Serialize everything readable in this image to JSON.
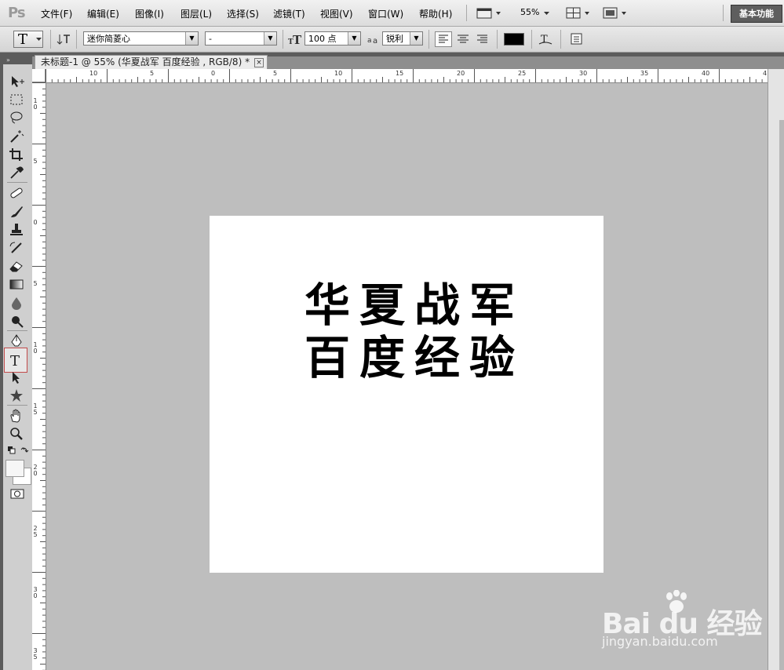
{
  "menubar": {
    "logo": "Ps",
    "items": [
      "文件(F)",
      "编辑(E)",
      "图像(I)",
      "图层(L)",
      "选择(S)",
      "滤镜(T)",
      "视图(V)",
      "窗口(W)",
      "帮助(H)"
    ],
    "zoom": "55%",
    "workspace_label": "基本功能"
  },
  "options": {
    "tool_glyph": "T",
    "font_family": "迷你简菱心",
    "font_style": "-",
    "font_size": "100 点",
    "antialias": "锐利",
    "text_color": "#000000"
  },
  "document": {
    "tab_title": "未标题-1 @ 55% (华夏战军 百度经验 , RGB/8) *",
    "close_glyph": "×",
    "text_lines": [
      "华夏战军",
      "百度经验"
    ]
  },
  "ruler_top_labels": [
    "10",
    "5",
    "0",
    "5",
    "10",
    "15",
    "20",
    "25",
    "30",
    "35",
    "40",
    "4"
  ],
  "ruler_left_labels": [
    "1 0",
    "5",
    "0",
    "5",
    "1 0",
    "1 5",
    "2 0",
    "2 5",
    "3 0",
    "3 5"
  ],
  "watermark": {
    "brand": "Bai du 经验",
    "site": "jingyan.baidu.com"
  }
}
